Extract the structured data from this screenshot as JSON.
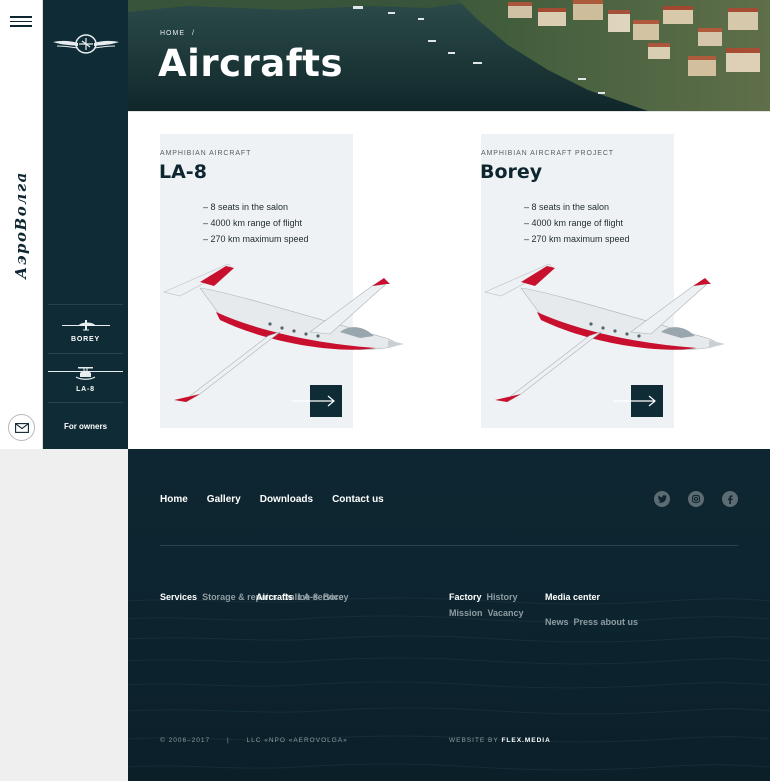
{
  "header": {
    "menu_icon": "hamburger-menu-icon",
    "brand_text": "АэроВолга",
    "mail_icon": "envelope-icon"
  },
  "sidebar": {
    "logo_icon": "winged-aircraft-logo-icon",
    "models": [
      {
        "label": "BOREY",
        "icon": "aircraft-silhouette-icon"
      },
      {
        "label": "LA-8",
        "icon": "amphibian-silhouette-icon"
      }
    ],
    "for_owners": "For owners"
  },
  "hero": {
    "breadcrumb_home": "HOME",
    "breadcrumb_sep": "/",
    "title": "Aircrafts"
  },
  "aircrafts": [
    {
      "eyebrow": "AMPHIBIAN AIRCRAFT",
      "name": "LA-8",
      "specs": [
        "– 8 seats in the salon",
        "– 4000 km range of flight",
        "– 270 km maximum speed"
      ],
      "arrow_icon": "arrow-right-icon"
    },
    {
      "eyebrow": "AMPHIBIAN AIRCRAFT PROJECT",
      "name": "Borey",
      "specs": [
        "– 8 seats in the salon",
        "– 4000 km range of flight",
        "– 270 km maximum speed"
      ],
      "arrow_icon": "arrow-right-icon"
    }
  ],
  "footer": {
    "nav": [
      "Home",
      "Gallery",
      "Downloads",
      "Contact us"
    ],
    "social": [
      "twitter-icon",
      "instagram-icon",
      "facebook-icon"
    ],
    "col1": {
      "services": "Services",
      "storage": "Storage & repairs",
      "online": "Online service",
      "aircrafts": "Aircrafts",
      "la8": "LA-8",
      "borey": "Borey"
    },
    "col2": {
      "factory": "Factory",
      "history": "History",
      "mission": "Mission",
      "vacancy": "Vacancy",
      "media": "Media center",
      "news": "News",
      "press": "Press about us"
    },
    "copyright": "© 2006–2017",
    "divider": "|",
    "company": "LLC «NPO «AEROVOLGA»",
    "made_by_prefix": "WEBSITE BY",
    "made_by": "FLEX.MEDIA"
  },
  "colors": {
    "dark": "#0f2b35",
    "panel": "#eff2f5",
    "accent_red": "#c8102e"
  }
}
